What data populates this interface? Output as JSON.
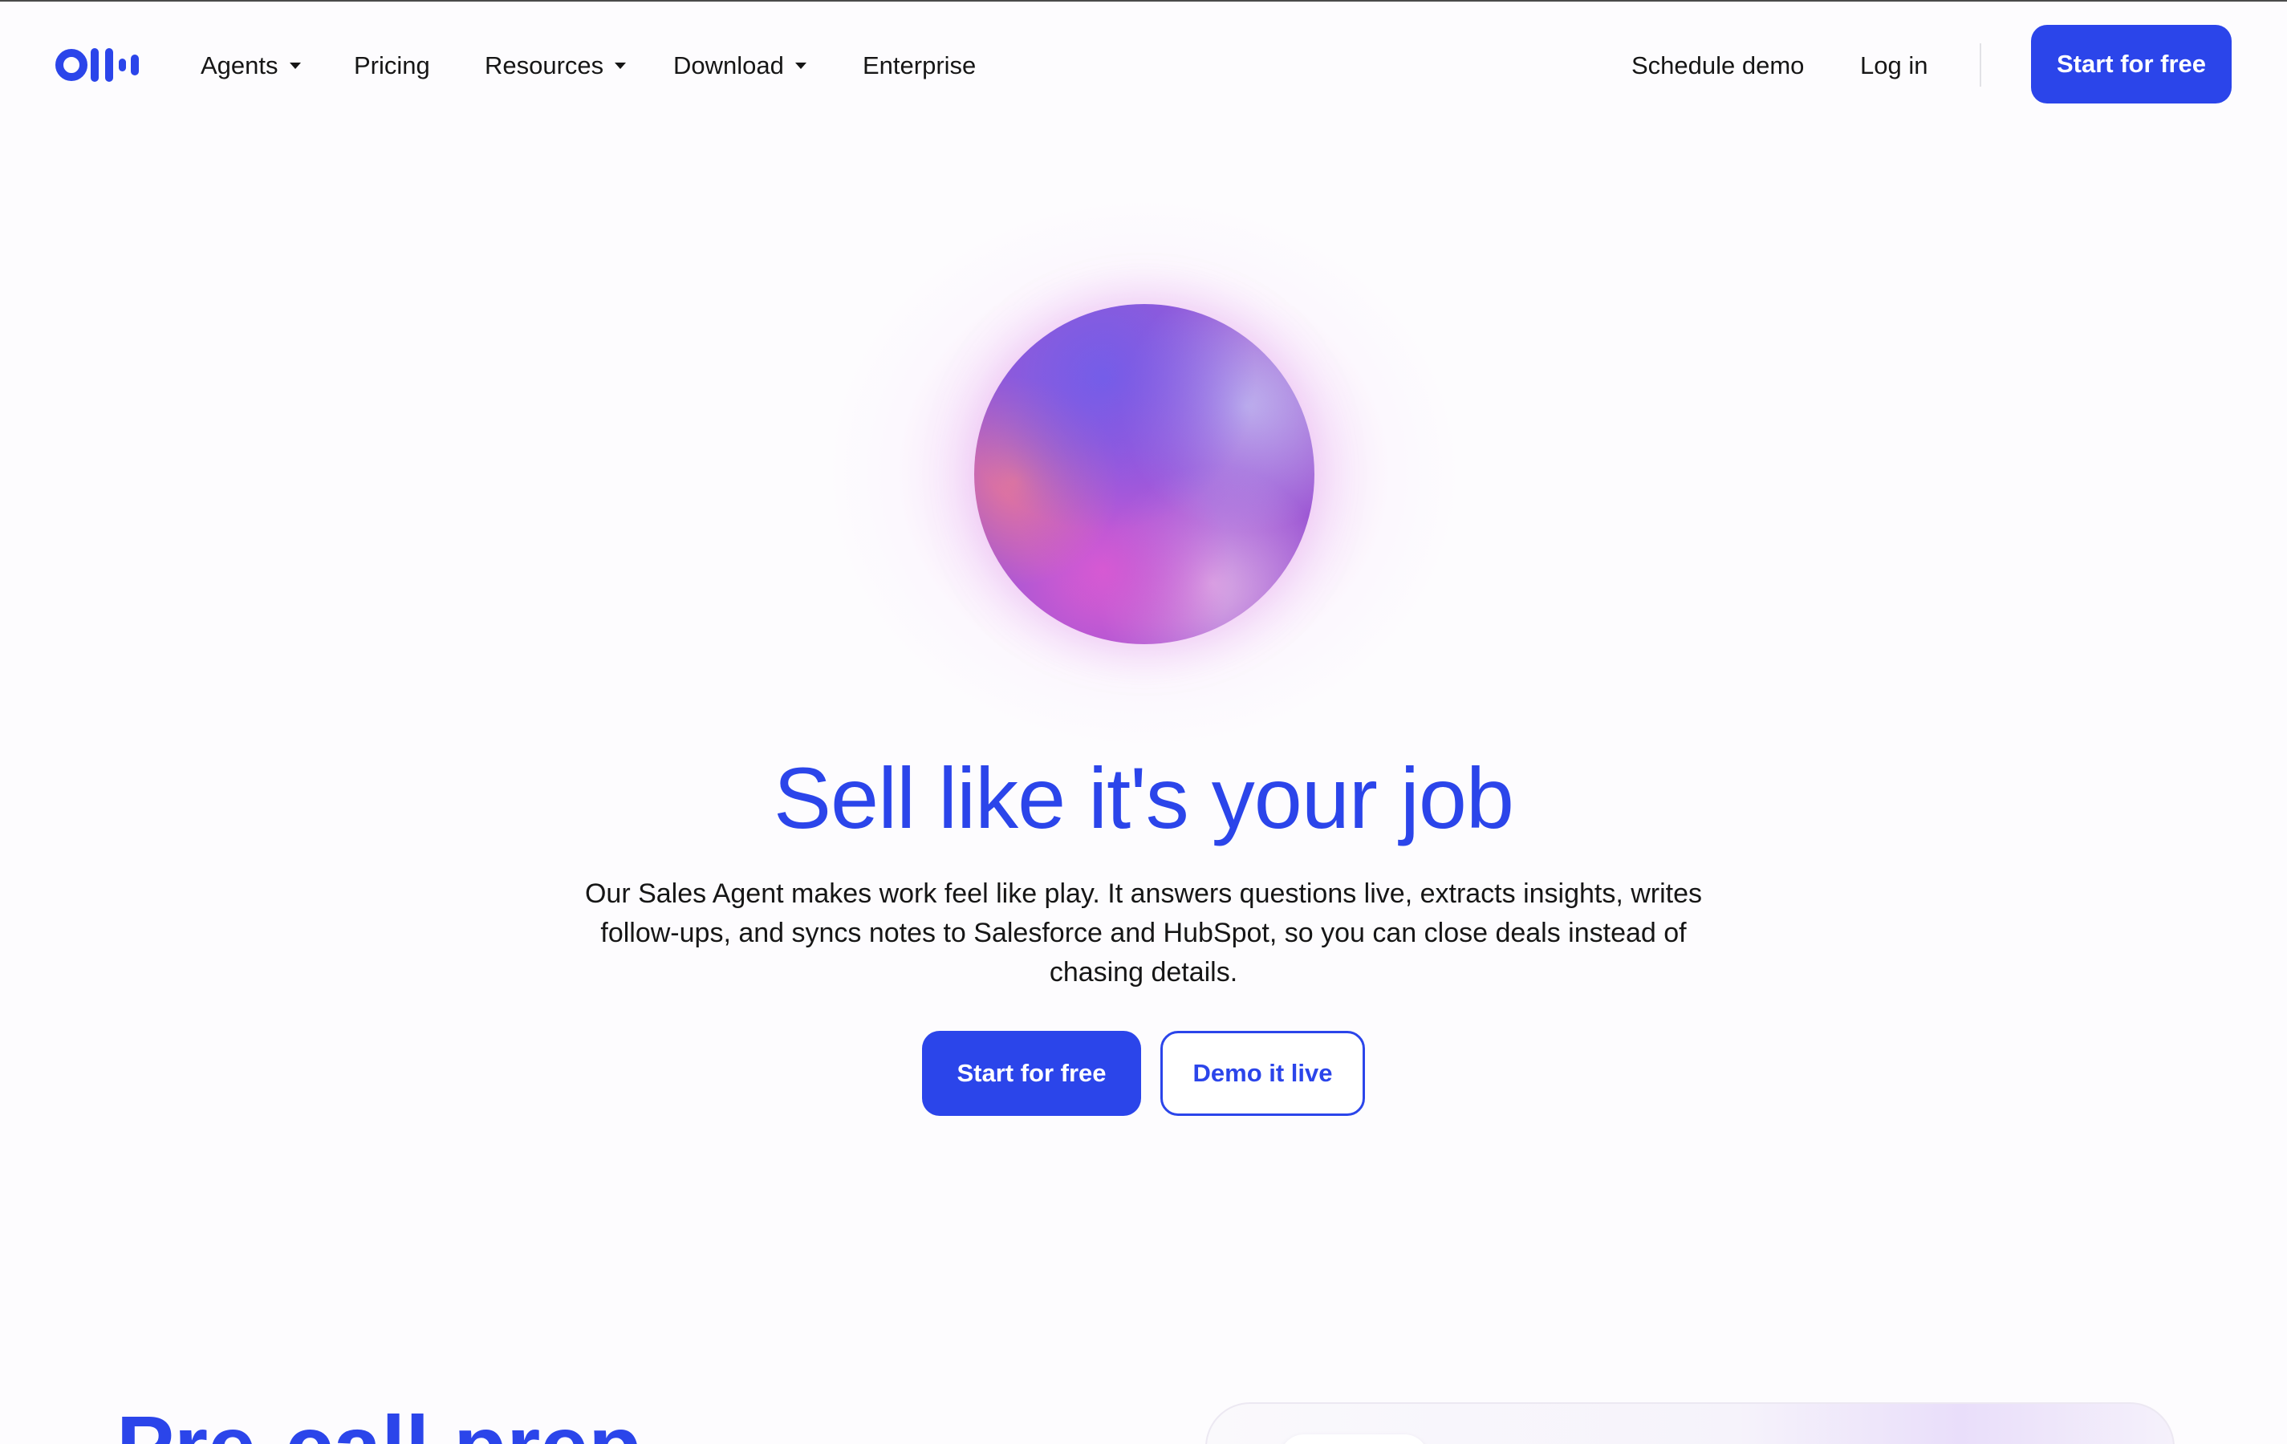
{
  "header": {
    "logo_alt": "Otter logo",
    "nav": [
      {
        "label": "Agents",
        "has_dropdown": true
      },
      {
        "label": "Pricing",
        "has_dropdown": false
      },
      {
        "label": "Resources",
        "has_dropdown": true
      },
      {
        "label": "Download",
        "has_dropdown": true
      },
      {
        "label": "Enterprise",
        "has_dropdown": false
      }
    ],
    "schedule_demo": "Schedule demo",
    "log_in": "Log in",
    "cta": "Start for free"
  },
  "hero": {
    "title": "Sell like it's your job",
    "subtitle": "Our Sales Agent makes work feel like play. It answers questions live, extracts insights, writes follow-ups, and syncs notes to Salesforce and HubSpot, so you can close deals instead of chasing details.",
    "primary_button": "Start for free",
    "secondary_button": "Demo it live"
  },
  "next_section": {
    "heading": "Pre-call prep"
  },
  "colors": {
    "brand_blue": "#2b45ea",
    "text": "#161616",
    "background": "#fdfcfe"
  }
}
